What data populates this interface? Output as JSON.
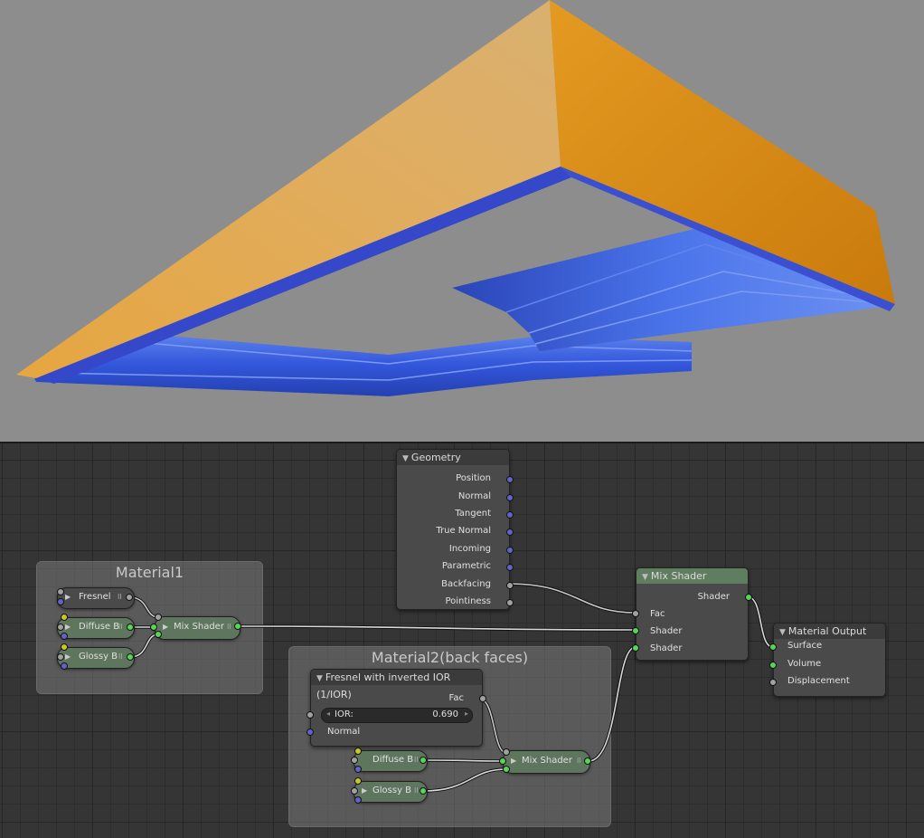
{
  "viewport": {
    "background_color": "#8d8d8d",
    "object_colors": {
      "front_face": "#e8a944",
      "back_face": "#3556d8"
    }
  },
  "node_editor": {
    "frames": [
      {
        "id": "material1",
        "label": "Material1"
      },
      {
        "id": "material2",
        "label": "Material2(back faces)"
      }
    ],
    "geometry_node": {
      "title": "Geometry",
      "outputs": [
        "Position",
        "Normal",
        "Tangent",
        "True Normal",
        "Incoming",
        "Parametric",
        "Backfacing",
        "Pointiness"
      ]
    },
    "mix_shader_main": {
      "title": "Mix Shader",
      "output": "Shader",
      "inputs": [
        "Fac",
        "Shader",
        "Shader"
      ]
    },
    "material_output": {
      "title": "Material Output",
      "inputs": [
        "Surface",
        "Volume",
        "Displacement"
      ]
    },
    "material1_nodes": {
      "fresnel": "Fresnel",
      "diffuse": "Diffuse B",
      "glossy": "Glossy B",
      "mix": "Mix Shader"
    },
    "fresnel_inverted": {
      "title": "Fresnel with inverted IOR (1/IOR)",
      "output": "Fac",
      "ior_label": "IOR:",
      "ior_value": "0.690",
      "normal_label": "Normal"
    },
    "material2_nodes": {
      "diffuse": "Diffuse B",
      "glossy": "Glossy B",
      "mix": "Mix Shader"
    },
    "socket_colors": {
      "vector": "#6363c7",
      "float": "#a1a1a1",
      "shader": "#5bd35b",
      "color": "#c7c729"
    }
  }
}
